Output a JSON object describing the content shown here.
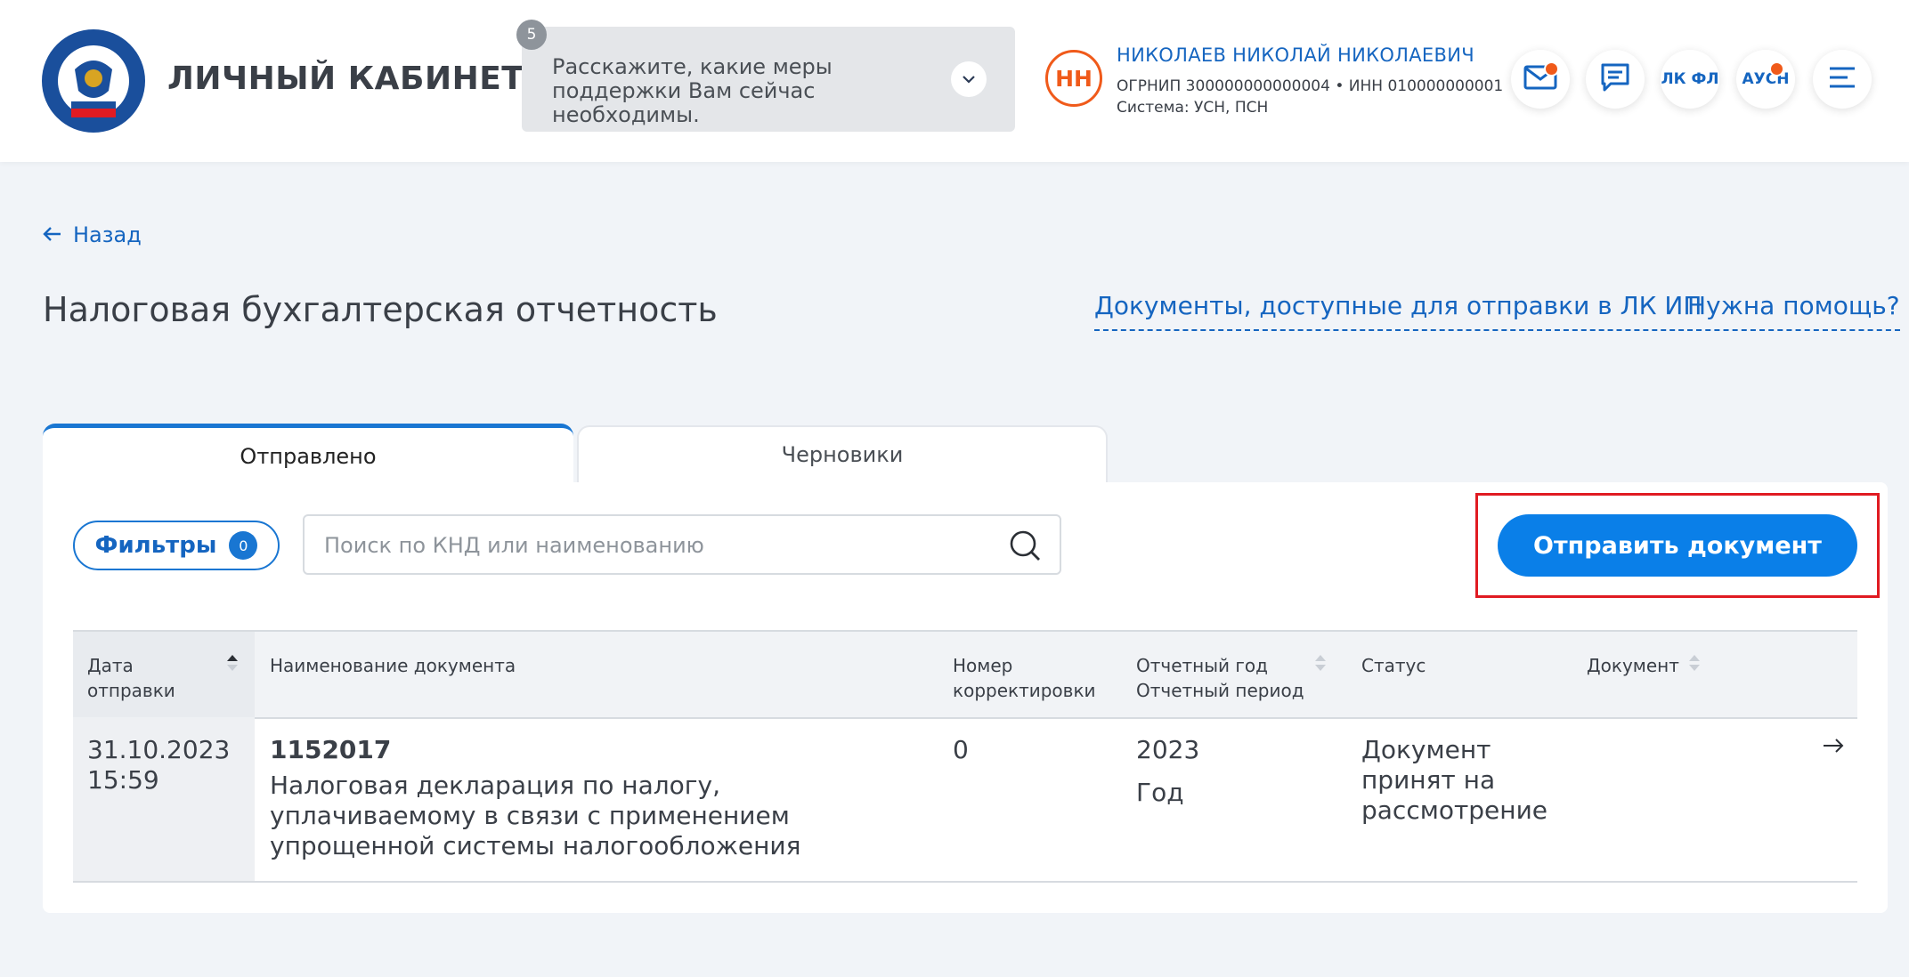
{
  "header": {
    "app_title": "ЛИЧНЫЙ КАБИНЕТ ИП",
    "survey": {
      "badge": "5",
      "text": "Расскажите, какие меры поддержки Вам сейчас необходимы."
    },
    "user": {
      "initials": "НН",
      "name": "НИКОЛАЕВ НИКОЛАЙ НИКОЛАЕВИЧ",
      "ids": "ОГРНИП 300000000000004 • ИНН 010000000001",
      "system": "Система: УСН, ПСН"
    },
    "buttons": {
      "lk_fl": "ЛК ФЛ",
      "ausn": "АУСН"
    }
  },
  "page": {
    "back_label": "Назад",
    "title": "Налоговая бухгалтерская отчетность",
    "link_documents": "Документы, доступные для отправки в ЛК ИП",
    "link_help": "Нужна помощь?"
  },
  "tabs": [
    {
      "label": "Отправлено",
      "active": true
    },
    {
      "label": "Черновики",
      "active": false
    }
  ],
  "toolbar": {
    "filters_label": "Фильтры",
    "filters_count": "0",
    "search_placeholder": "Поиск по КНД или наименованию",
    "send_label": "Отправить документ"
  },
  "table": {
    "columns": {
      "date": "Дата отправки",
      "name": "Наименование документа",
      "correction": "Номер корректировки",
      "year": "Отчетный год",
      "period": "Отчетный период",
      "status": "Статус",
      "document": "Документ"
    },
    "rows": [
      {
        "date": "31.10.2023",
        "time": "15:59",
        "code": "1152017",
        "name": "Налоговая декларация по налогу, уплачиваемому в связи с применением упрощенной системы налогообложения",
        "correction": "0",
        "year": "2023",
        "period": "Год",
        "status": "Документ принят на рассмотрение"
      }
    ]
  },
  "colors": {
    "accent": "#0a7fe8",
    "link": "#1565c0",
    "notification": "#f05a1a",
    "highlight": "#e01b22"
  }
}
